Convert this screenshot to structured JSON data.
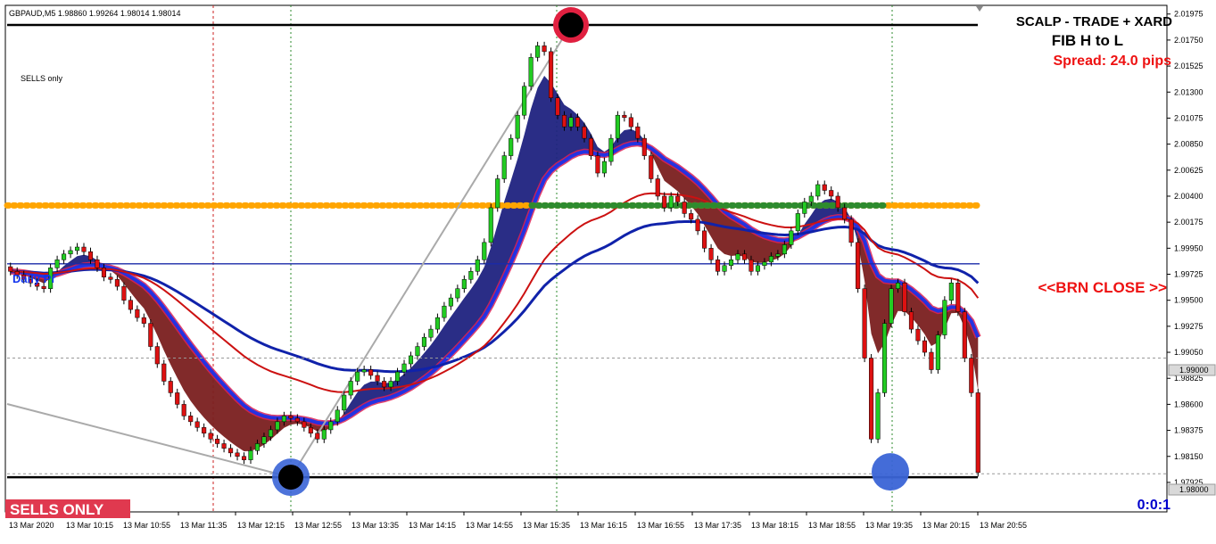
{
  "chart_header": "GBPAUD,M5  1.98860 1.99264 1.98014 1.98014",
  "sells_note": "SELLS only",
  "panel": {
    "line1": "SCALP - TRADE + XARD",
    "line2": "FIB H to L",
    "spread": "Spread: 24.0 pips"
  },
  "brn_close_label": "<<BRN CLOSE >>",
  "sells_only_badge": "SELLS ONLY",
  "ratio_label": "0:0:1",
  "daily_label": "Daily Pr",
  "current_price_tag": "1.99000",
  "bottom_price_tag": "1.98000",
  "colors": {
    "bull": "#22cc22",
    "bear": "#dd1111",
    "up_cloud": "#1f2280",
    "down_cloud": "#7a1f1f",
    "blue_band": "#1133ee",
    "red_band": "#dd2255",
    "orange_level": "#ffa500",
    "green_level": "#2e8b2e",
    "sells_badge": "#e0394f",
    "panel_red": "#ee1111",
    "ratio_blue": "#0000cc"
  },
  "chart_data": {
    "type": "candlestick",
    "symbol": "GBPAUD",
    "timeframe": "M5",
    "ylim": [
      1.9767,
      2.0205
    ],
    "y_ticks": [
      "2.01975",
      "2.01750",
      "2.01525",
      "2.01300",
      "2.01075",
      "2.00850",
      "2.00625",
      "2.00400",
      "2.00175",
      "1.99950",
      "1.99725",
      "1.99500",
      "1.99275",
      "1.99050",
      "1.98825",
      "1.98600",
      "1.98375",
      "1.98150",
      "1.97925"
    ],
    "x_ticks": [
      "13 Mar 2020",
      "13 Mar 10:15",
      "13 Mar 10:55",
      "13 Mar 11:35",
      "13 Mar 12:15",
      "13 Mar 12:55",
      "13 Mar 13:35",
      "13 Mar 14:15",
      "13 Mar 14:55",
      "13 Mar 15:35",
      "13 Mar 16:15",
      "13 Mar 16:55",
      "13 Mar 17:35",
      "13 Mar 18:15",
      "13 Mar 18:55",
      "13 Mar 19:35",
      "13 Mar 20:15",
      "13 Mar 20:55"
    ],
    "levels": {
      "fib_high": 2.0188,
      "fib_low": 1.9797,
      "orange_level": 2.0032,
      "blue_level": 1.99815,
      "gray_dashed_1": 1.99,
      "gray_dashed_2": 1.98
    },
    "closes": [
      1.9975,
      1.9972,
      1.9968,
      1.9965,
      1.9962,
      1.996,
      1.9978,
      1.9985,
      1.999,
      1.9993,
      1.9996,
      1.9992,
      1.9985,
      1.9978,
      1.997,
      1.9968,
      1.9962,
      1.995,
      1.9942,
      1.9935,
      1.993,
      1.991,
      1.9895,
      1.988,
      1.987,
      1.986,
      1.985,
      1.9845,
      1.984,
      1.9835,
      1.983,
      1.9826,
      1.9822,
      1.9818,
      1.9815,
      1.9812,
      1.982,
      1.9826,
      1.9832,
      1.9838,
      1.9845,
      1.985,
      1.9848,
      1.9845,
      1.984,
      1.9835,
      1.983,
      1.9838,
      1.9845,
      1.9855,
      1.9868,
      1.988,
      1.9888,
      1.989,
      1.9885,
      1.988,
      1.9875,
      1.988,
      1.9888,
      1.9895,
      1.9902,
      1.991,
      1.9918,
      1.9925,
      1.9935,
      1.9945,
      1.9952,
      1.996,
      1.9968,
      1.9975,
      1.9985,
      2.0,
      2.003,
      2.0055,
      2.0075,
      2.009,
      2.011,
      2.0135,
      2.016,
      2.017,
      2.0165,
      2.0125,
      2.011,
      2.01,
      2.0108,
      2.01,
      2.009,
      2.0075,
      2.006,
      2.007,
      2.009,
      2.011,
      2.0108,
      2.01,
      2.009,
      2.0075,
      2.0055,
      2.004,
      2.003,
      2.004,
      2.0035,
      2.0025,
      2.002,
      2.001,
      1.9995,
      1.9985,
      1.9975,
      1.998,
      1.9985,
      1.999,
      1.9985,
      1.9975,
      1.998,
      1.9983,
      1.9988,
      1.999,
      1.9998,
      2.001,
      2.0025,
      2.0035,
      2.004,
      2.005,
      2.0045,
      2.004,
      2.003,
      2.002,
      2.0,
      1.996,
      1.99,
      1.983,
      1.987,
      1.993,
      1.996,
      1.9965,
      1.994,
      1.9925,
      1.9915,
      1.9905,
      1.989,
      1.992,
      1.995,
      1.9965,
      1.994,
      1.99,
      1.987,
      1.9801
    ]
  }
}
